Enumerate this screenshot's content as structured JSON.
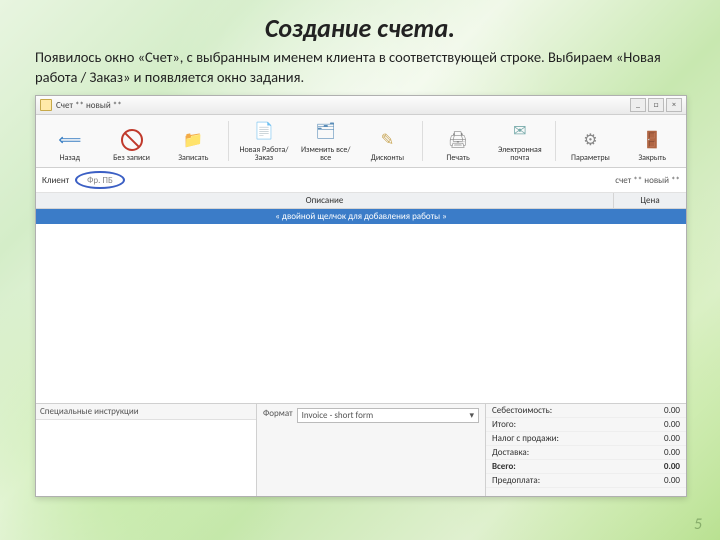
{
  "slide": {
    "title": "Создание счета.",
    "intro": "Появилось окно «Счет», с выбранным именем клиента в соответствующей строке. Выбираем «Новая работа / Заказ» и появляется окно задания.",
    "page_number": "5"
  },
  "window": {
    "title": "Счет ** новый **",
    "controls": {
      "min": "_",
      "max": "□",
      "close": "×"
    }
  },
  "toolbar": {
    "back": "Назад",
    "nosave": "Без записи",
    "save": "Записать",
    "newjob": "Новая Работа/Заказ",
    "changeall": "Изменить все/все",
    "discounts": "Дисконты",
    "print": "Печать",
    "email": "Электронная почта",
    "options": "Параметры",
    "close": "Закрыть"
  },
  "client": {
    "label": "Клиент",
    "value": "Фр. ПБ",
    "record": "счет ** новый **"
  },
  "columns": {
    "desc": "Описание",
    "price": "Цена"
  },
  "addrow": "« двойной щелчок для добавления работы »",
  "bottom_left": {
    "header": "Специальные инструкции"
  },
  "bottom_mid": {
    "label": "Формат",
    "value": "Invoice - short form",
    "chev": "▾"
  },
  "totals": {
    "rows": [
      {
        "k": "Себестоимость:",
        "v": "0.00"
      },
      {
        "k": "Итого:",
        "v": "0.00"
      },
      {
        "k": "Налог с продажи:",
        "v": "0.00"
      },
      {
        "k": "Доставка:",
        "v": "0.00"
      },
      {
        "k": "Всего:",
        "v": "0.00",
        "b": true
      },
      {
        "k": "Предоплата:",
        "v": "0.00"
      }
    ]
  }
}
